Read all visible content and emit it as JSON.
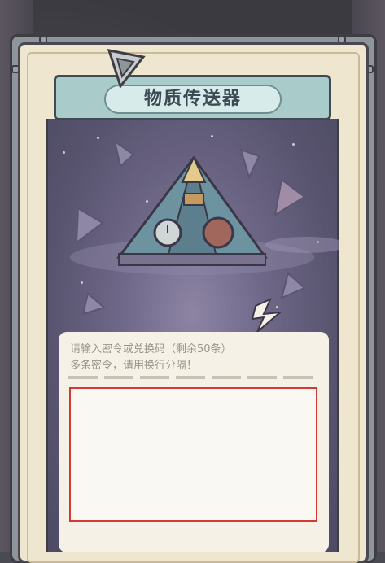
{
  "dialog": {
    "title": "物质传送器",
    "hint_line_1": "请输入密令或兑换码（剩余50条）",
    "hint_line_2": "多条密令，请用换行分隔！",
    "code_input_value": ""
  },
  "colors": {
    "title_bar": "#a9cccb",
    "scene_bg": "#6f6888",
    "input_highlight_border": "#d33a34",
    "panel": "#efe6cf"
  },
  "icons": [
    "triangle-badge-icon",
    "pyramid-teleporter-icon",
    "crystal-icon"
  ]
}
